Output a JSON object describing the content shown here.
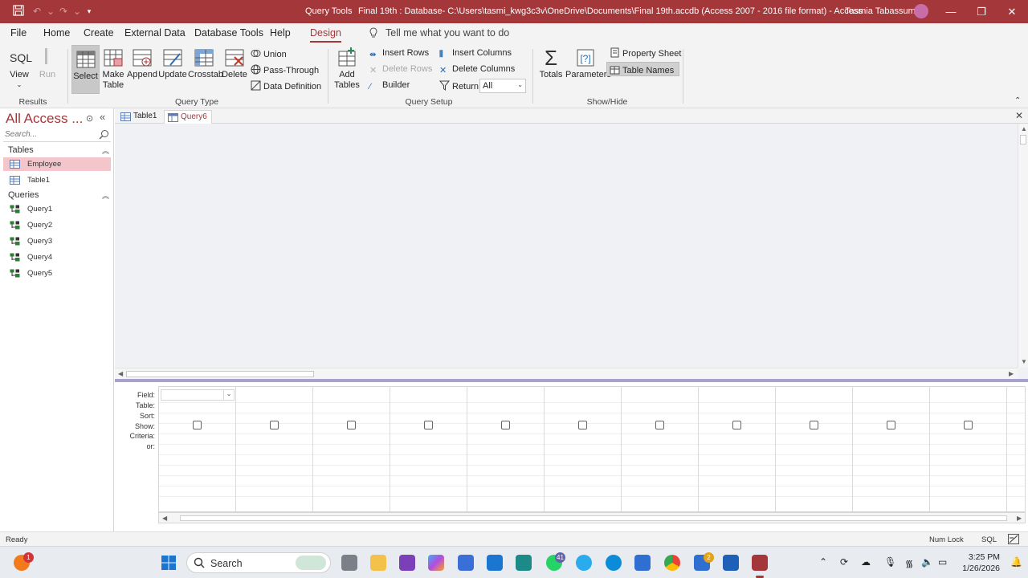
{
  "window": {
    "context_label": "Query Tools",
    "title": "Final 19th : Database- C:\\Users\\tasmi_kwg3c3v\\OneDrive\\Documents\\Final 19th.accdb (Access 2007 - 2016 file format)  -  Access",
    "user": "Tasmia Tabassum",
    "controls": {
      "minimize": "—",
      "restore": "❐",
      "close": "✕"
    }
  },
  "ribbon_tabs": [
    "File",
    "Home",
    "Create",
    "External Data",
    "Database Tools",
    "Help",
    "Design"
  ],
  "tell_me": "Tell me what you want to do",
  "ribbon": {
    "results": {
      "group": "Results",
      "sql": "SQL",
      "view": "View",
      "run": "Run"
    },
    "query_type": {
      "group": "Query Type",
      "select": "Select",
      "make_table_1": "Make",
      "make_table_2": "Table",
      "append": "Append",
      "update": "Update",
      "crosstab": "Crosstab",
      "delete": "Delete",
      "union": "Union",
      "pass_through": "Pass-Through",
      "data_definition": "Data Definition"
    },
    "query_setup": {
      "group": "Query Setup",
      "add_tables_1": "Add",
      "add_tables_2": "Tables",
      "insert_rows": "Insert Rows",
      "delete_rows": "Delete Rows",
      "builder": "Builder",
      "insert_columns": "Insert Columns",
      "delete_columns": "Delete Columns",
      "return_label": "Return:",
      "return_value": "All"
    },
    "show_hide": {
      "group": "Show/Hide",
      "totals": "Totals",
      "parameters": "Parameters",
      "property_sheet": "Property Sheet",
      "table_names": "Table Names"
    }
  },
  "nav": {
    "title": "All Access ...",
    "search_placeholder": "Search...",
    "sections": [
      {
        "label": "Tables",
        "items": [
          "Employee",
          "Table1"
        ]
      },
      {
        "label": "Queries",
        "items": [
          "Query1",
          "Query2",
          "Query3",
          "Query4",
          "Query5"
        ]
      }
    ]
  },
  "doc_tabs": [
    {
      "label": "Table1",
      "active": false
    },
    {
      "label": "Query6",
      "active": true
    }
  ],
  "qbe": {
    "row_labels": [
      "Field:",
      "Table:",
      "Sort:",
      "Show:",
      "Criteria:",
      "or:"
    ],
    "column_count": 11
  },
  "status": {
    "left": "Ready",
    "num_lock": "Num Lock",
    "view": "SQL"
  },
  "taskbar": {
    "search_text": "Search",
    "badges": {
      "start_app": "1",
      "whatsapp": "41",
      "store": "2"
    },
    "time": "3:25 PM",
    "date": "1/26/2026"
  },
  "colors": {
    "accent": "#a4373a",
    "nav_selected": "#f4c6cc",
    "design_bg": "#eff1f4",
    "splitter": "#a7a2cc"
  }
}
